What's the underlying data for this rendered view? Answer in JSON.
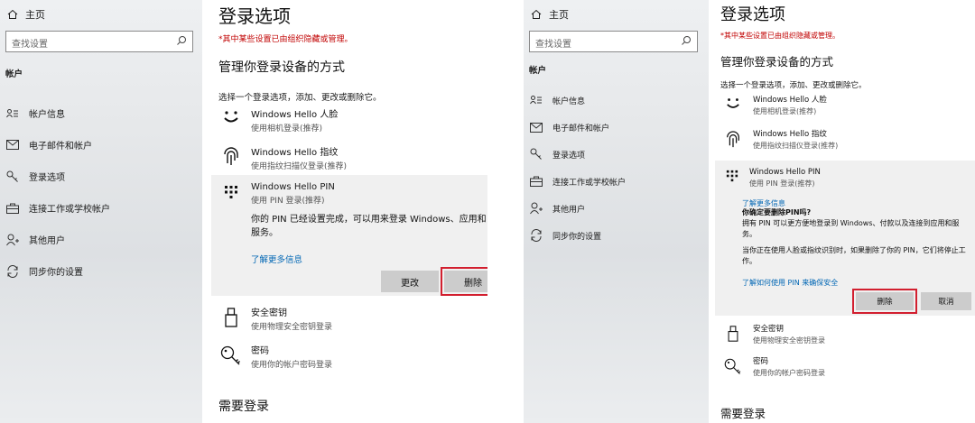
{
  "left": {
    "nav": {
      "home": "主页",
      "search_placeholder": "查找设置",
      "section": "帐户",
      "items": [
        "帐户信息",
        "电子邮件和帐户",
        "登录选项",
        "连接工作或学校帐户",
        "其他用户",
        "同步你的设置"
      ]
    },
    "content": {
      "title": "登录选项",
      "warning": "*其中某些设置已由组织隐藏或管理。",
      "heading": "管理你登录设备的方式",
      "description": "选择一个登录选项，添加、更改或删除它。",
      "options": {
        "face": {
          "title": "Windows Hello 人脸",
          "subtitle": "使用相机登录(推荐)"
        },
        "fingerprint": {
          "title": "Windows Hello 指纹",
          "subtitle": "使用指纹扫描仪登录(推荐)"
        },
        "pin": {
          "title": "Windows Hello PIN",
          "subtitle": "使用 PIN 登录(推荐)"
        },
        "key": {
          "title": "安全密钥",
          "subtitle": "使用物理安全密钥登录"
        },
        "password": {
          "title": "密码",
          "subtitle": "使用你的帐户密码登录"
        }
      },
      "pin_detail": "你的 PIN 已经设置完成，可以用来登录 Windows、应用和服务。",
      "learn_more": "了解更多信息",
      "change_button": "更改",
      "delete_button": "删除",
      "bottom_heading": "需要登录"
    }
  },
  "right": {
    "nav": {
      "home": "主页",
      "search_placeholder": "查找设置",
      "section": "帐户",
      "items": [
        "帐户信息",
        "电子邮件和帐户",
        "登录选项",
        "连接工作或学校帐户",
        "其他用户",
        "同步你的设置"
      ]
    },
    "content": {
      "title": "登录选项",
      "warning": "*其中某些设置已由组织隐藏或管理。",
      "heading": "管理你登录设备的方式",
      "description": "选择一个登录选项，添加、更改或删除它。",
      "options": {
        "face": {
          "title": "Windows Hello 人脸",
          "subtitle": "使用相机登录(推荐)"
        },
        "fingerprint": {
          "title": "Windows Hello 指纹",
          "subtitle": "使用指纹扫描仪登录(推荐)"
        },
        "pin": {
          "title": "Windows Hello PIN",
          "subtitle": "使用 PIN 登录(推荐)"
        },
        "key": {
          "title": "安全密钥",
          "subtitle": "使用物理安全密钥登录"
        },
        "password": {
          "title": "密码",
          "subtitle": "使用你的帐户密码登录"
        }
      },
      "learn_more": "了解更多信息",
      "confirm_question": "你确定要删除PIN吗?",
      "confirm_text_1": "拥有 PIN 可以更方便地登录到 Windows、付款以及连接到应用和服务。",
      "confirm_text_2": "当你正在使用人脸或指纹识别时，如果删除了你的 PIN，它们将停止工作。",
      "security_link": "了解如何使用 PIN 来确保安全",
      "delete_button": "删除",
      "cancel_button": "取消",
      "bottom_heading": "需要登录"
    }
  },
  "colors": {
    "warning": "#c00000",
    "link": "#0066b4",
    "highlight": "#d21f2f",
    "button": "#cccccc"
  }
}
